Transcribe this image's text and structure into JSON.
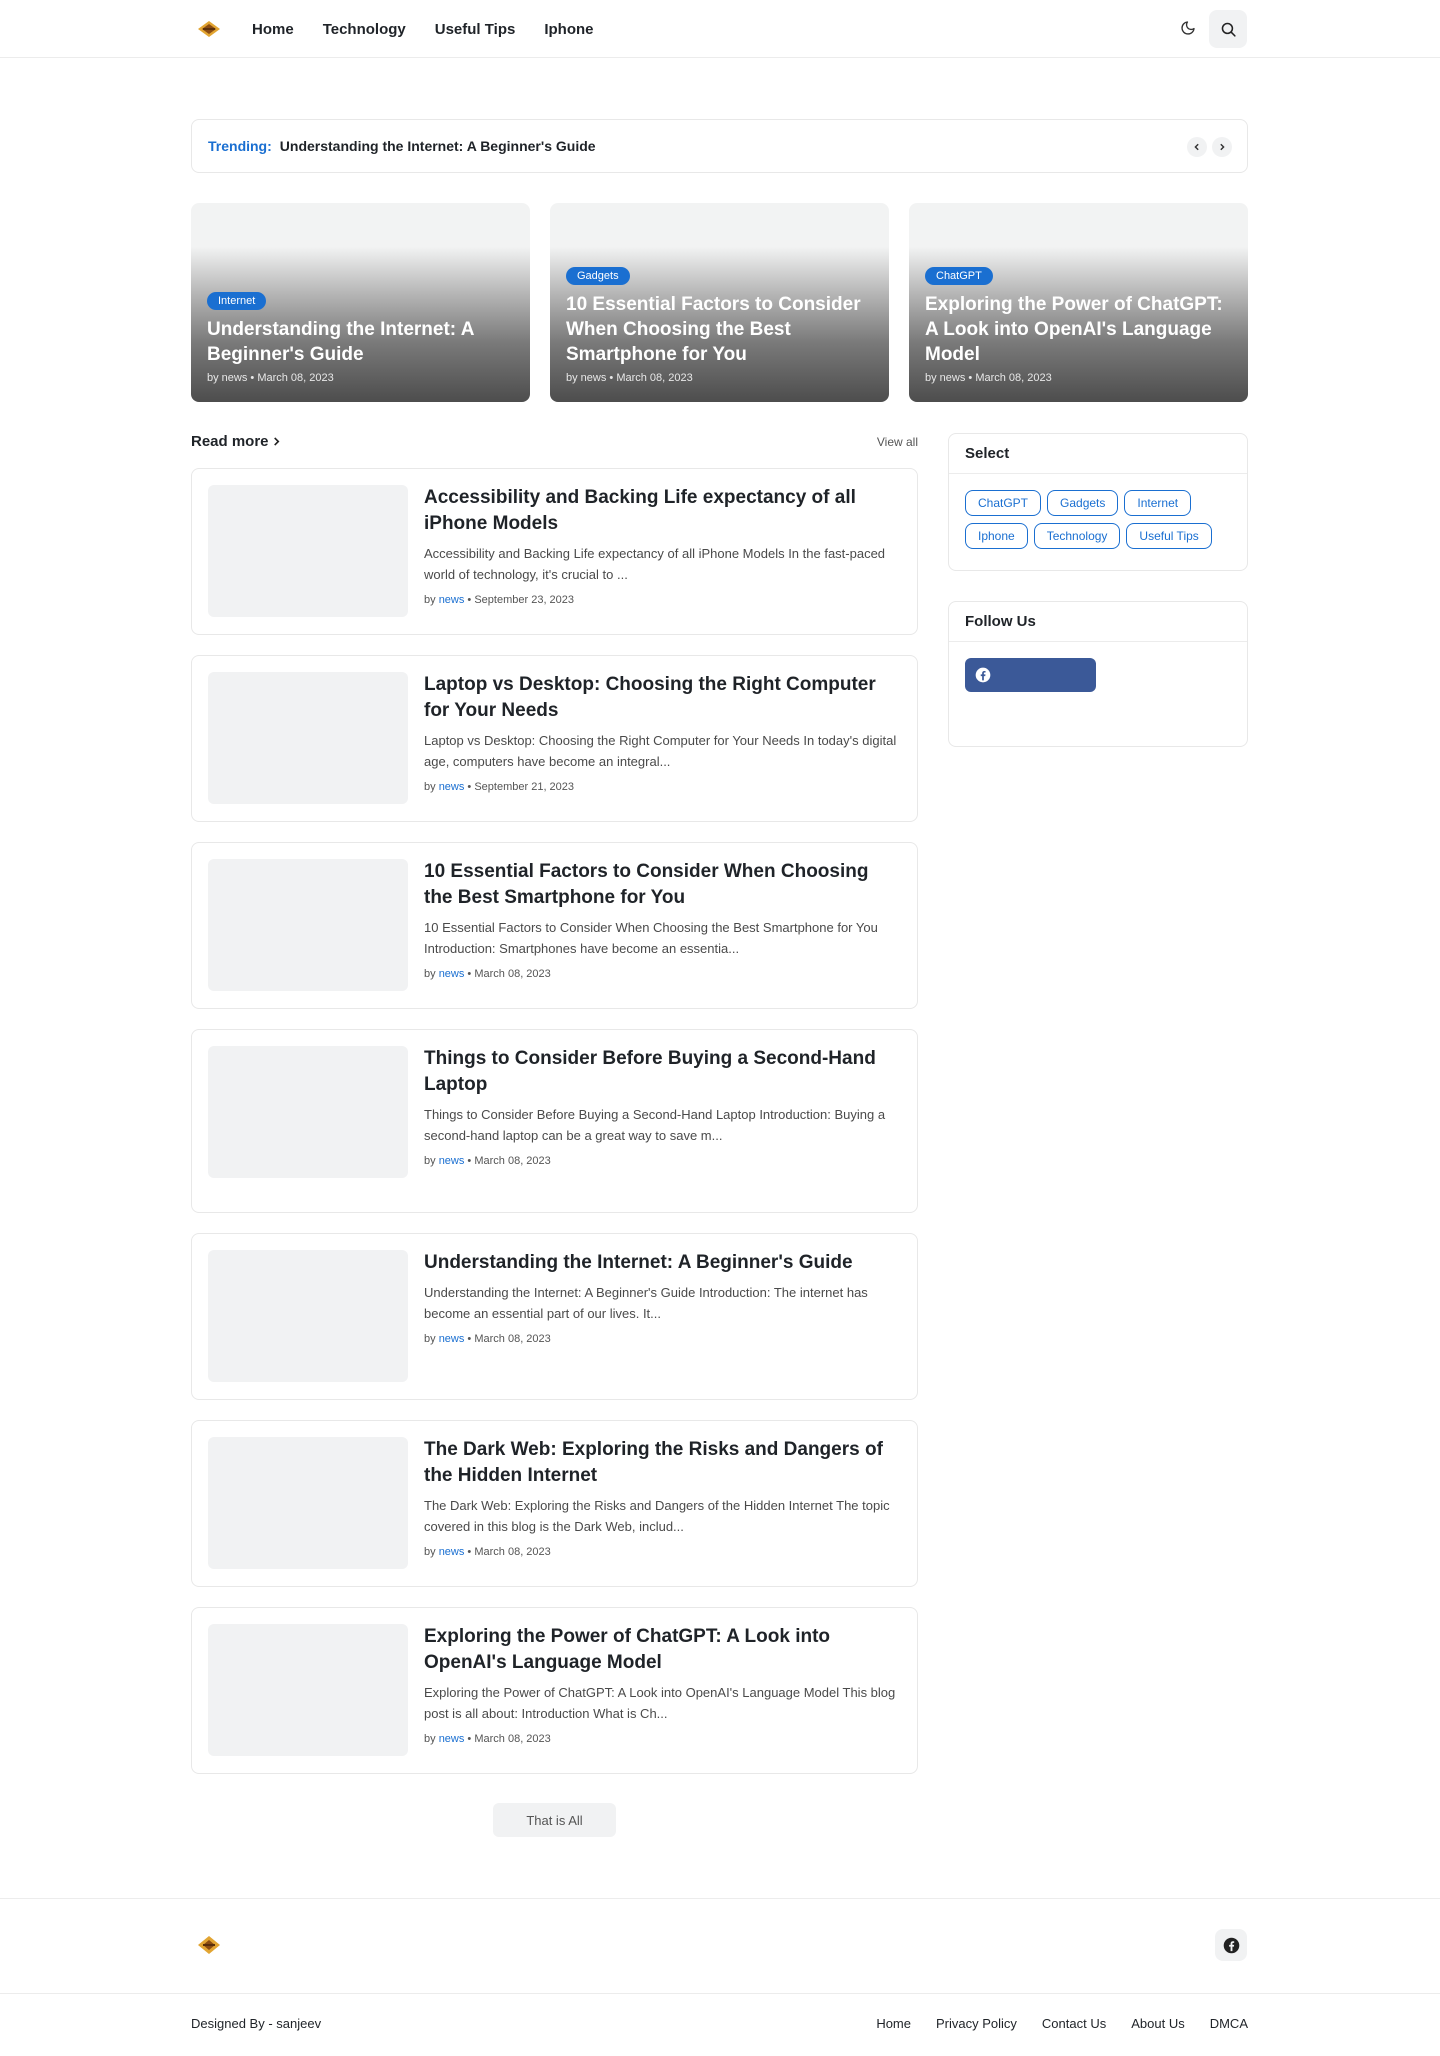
{
  "nav": {
    "items": [
      "Home",
      "Technology",
      "Useful Tips",
      "Iphone"
    ]
  },
  "trending": {
    "label": "Trending:",
    "title": "Understanding the Internet: A Beginner's Guide"
  },
  "hero": [
    {
      "badge": "Internet",
      "title": "Understanding the Internet: A Beginner's Guide",
      "meta": "by news • March 08, 2023"
    },
    {
      "badge": "Gadgets",
      "title": "10 Essential Factors to Consider When Choosing the Best Smartphone for You",
      "meta": "by news • March 08, 2023"
    },
    {
      "badge": "ChatGPT",
      "title": "Exploring the Power of ChatGPT: A Look into OpenAI's Language Model",
      "meta": "by news • March 08, 2023"
    }
  ],
  "section": {
    "title": "Read more",
    "view_all": "View all"
  },
  "posts": [
    {
      "title": "Accessibility and Backing Life expectancy of all iPhone Models",
      "snippet": "Accessibility and Backing Life expectancy of all iPhone Models In the fast-paced world of technology, it's crucial to ...",
      "by": "by",
      "author": "news",
      "date": " • September 23, 2023"
    },
    {
      "title": "Laptop vs Desktop: Choosing the Right Computer for Your Needs",
      "snippet": "Laptop vs Desktop: Choosing the Right Computer for Your Needs In today's digital age, computers have become an integral...",
      "by": "by",
      "author": "news",
      "date": " • September 21, 2023"
    },
    {
      "title": "10 Essential Factors to Consider When Choosing the Best Smartphone for You",
      "snippet": "10 Essential Factors to Consider When Choosing the Best Smartphone for You Introduction: Smartphones have become an essentia...",
      "by": "by",
      "author": "news",
      "date": " • March 08, 2023"
    },
    {
      "title": "Things to Consider Before Buying a Second-Hand Laptop",
      "snippet": "Things to Consider Before Buying a Second-Hand Laptop Introduction: Buying a second-hand laptop can be a great way to save m...",
      "by": "by",
      "author": "news",
      "date": " • March 08, 2023"
    },
    {
      "title": "Understanding the Internet: A Beginner's Guide",
      "snippet": "Understanding the Internet: A Beginner's Guide Introduction: The internet has become an essential part of our lives. It...",
      "by": "by",
      "author": "news",
      "date": " • March 08, 2023"
    },
    {
      "title": "The Dark Web: Exploring the Risks and Dangers of the Hidden Internet",
      "snippet": "The Dark Web: Exploring the Risks and Dangers of the Hidden Internet The topic covered in this blog is the Dark Web, includ...",
      "by": "by",
      "author": "news",
      "date": " • March 08, 2023"
    },
    {
      "title": "Exploring the Power of ChatGPT: A Look into OpenAI's Language Model",
      "snippet": "Exploring the Power of ChatGPT: A Look into OpenAI's Language Model This blog post is all about: Introduction What is Ch...",
      "by": "by",
      "author": "news",
      "date": " • March 08, 2023"
    }
  ],
  "load_more": "That is All",
  "sidebar": {
    "select_title": "Select",
    "tags": [
      "ChatGPT",
      "Gadgets",
      "Internet",
      "Iphone",
      "Technology",
      "Useful Tips"
    ],
    "follow_title": "Follow Us"
  },
  "footer": {
    "credit": "Designed By - sanjeev",
    "links": [
      "Home",
      "Privacy Policy",
      "Contact Us",
      "About Us",
      "DMCA"
    ]
  },
  "colors": {
    "accent": "#1a6fd1",
    "facebook": "#3b5998",
    "border": "#e8e8e8",
    "placeholder": "#f1f2f3"
  }
}
